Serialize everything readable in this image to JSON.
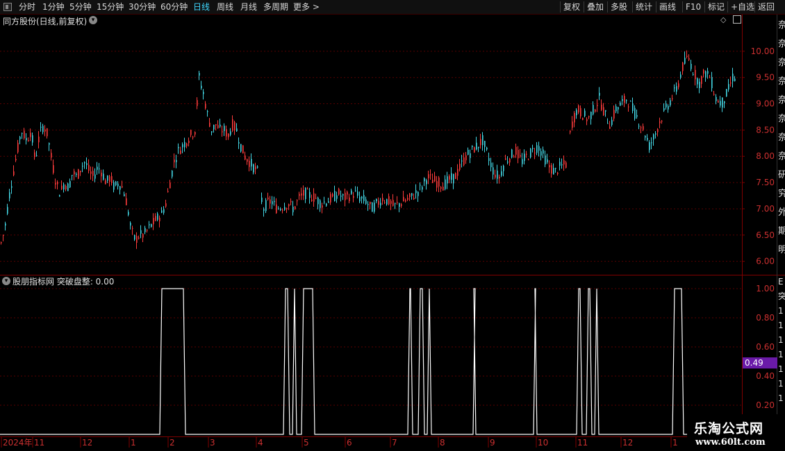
{
  "toolbar": {
    "left": [
      {
        "label": "分时",
        "x": 27
      },
      {
        "label": "1分钟",
        "x": 61
      },
      {
        "label": "5分钟",
        "x": 100
      },
      {
        "label": "15分钟",
        "x": 139
      },
      {
        "label": "30分钟",
        "x": 185
      },
      {
        "label": "60分钟",
        "x": 231
      },
      {
        "label": "日线",
        "x": 278,
        "active": true
      },
      {
        "label": "周线",
        "x": 312
      },
      {
        "label": "月线",
        "x": 346
      },
      {
        "label": "多周期",
        "x": 379
      },
      {
        "label": "更多 >",
        "x": 422
      }
    ],
    "right": [
      {
        "label": "复权",
        "x": 811
      },
      {
        "label": "叠加",
        "x": 845
      },
      {
        "label": "多股",
        "x": 879
      },
      {
        "label": "统计",
        "x": 915
      },
      {
        "label": "画线",
        "x": 949
      },
      {
        "label": "F10",
        "x": 987
      },
      {
        "label": "标记",
        "x": 1019
      },
      {
        "label": "+自选",
        "x": 1052
      },
      {
        "label": "返回",
        "x": 1091
      }
    ]
  },
  "main": {
    "title": "同方股份(日线,前复权)",
    "y_ticks": [
      "10.00",
      "9.50",
      "9.00",
      "8.50",
      "8.00",
      "7.50",
      "7.00",
      "6.50",
      "6.00"
    ],
    "right_edge_text": "奈奈奈奈奈奈奈奈研究外期明",
    "colors": {
      "up": "#ff3c3c",
      "down": "#44d8e6",
      "grid": "#5a0000",
      "border": "#800000"
    }
  },
  "indicator": {
    "title": "股朋指标网 突破盘整: 0.00",
    "y_ticks": [
      "1.00",
      "0.80",
      "0.60",
      "0.40",
      "0.20"
    ],
    "cursor_value": "0.49",
    "cursor_color": "#6a1aa8",
    "right_edge_text": "E突1111111",
    "line_color": "#ffffff"
  },
  "x_axis": {
    "labels": [
      {
        "t": "2024年",
        "x": 2
      },
      {
        "t": "11",
        "x": 47
      },
      {
        "t": "12",
        "x": 116
      },
      {
        "t": "1",
        "x": 186
      },
      {
        "t": "2",
        "x": 242
      },
      {
        "t": "3",
        "x": 300
      },
      {
        "t": "4",
        "x": 369
      },
      {
        "t": "5",
        "x": 435
      },
      {
        "t": "6",
        "x": 497
      },
      {
        "t": "7",
        "x": 562
      },
      {
        "t": "8",
        "x": 631
      },
      {
        "t": "9",
        "x": 703
      },
      {
        "t": "10",
        "x": 772
      },
      {
        "t": "11",
        "x": 829
      },
      {
        "t": "12",
        "x": 894
      },
      {
        "t": "1",
        "x": 966
      }
    ]
  },
  "watermark": {
    "line1": "乐淘公式网",
    "line2": "www.60lt.com"
  },
  "chart_data": [
    {
      "type": "candlestick",
      "title": "同方股份(日线,前复权)",
      "ylim": [
        5.85,
        10.5
      ],
      "anchors": [
        [
          0,
          6.3
        ],
        [
          6,
          6.6
        ],
        [
          12,
          7.2
        ],
        [
          20,
          7.8
        ],
        [
          30,
          8.5
        ],
        [
          38,
          8.3
        ],
        [
          44,
          8.5
        ],
        [
          50,
          7.9
        ],
        [
          56,
          8.4
        ],
        [
          62,
          8.6
        ],
        [
          68,
          8.4
        ],
        [
          74,
          7.9
        ],
        [
          80,
          7.5
        ],
        [
          86,
          7.3
        ],
        [
          92,
          7.5
        ],
        [
          98,
          7.4
        ],
        [
          104,
          7.7
        ],
        [
          110,
          7.6
        ],
        [
          116,
          7.8
        ],
        [
          122,
          7.9
        ],
        [
          128,
          7.7
        ],
        [
          134,
          7.6
        ],
        [
          140,
          7.8
        ],
        [
          146,
          7.7
        ],
        [
          152,
          7.5
        ],
        [
          158,
          7.6
        ],
        [
          164,
          7.4
        ],
        [
          170,
          7.5
        ],
        [
          176,
          7.4
        ],
        [
          182,
          7.1
        ],
        [
          188,
          6.6
        ],
        [
          194,
          6.4
        ],
        [
          200,
          6.5
        ],
        [
          206,
          6.5
        ],
        [
          212,
          6.6
        ],
        [
          218,
          6.7
        ],
        [
          224,
          6.8
        ],
        [
          232,
          6.9
        ],
        [
          238,
          7.1
        ],
        [
          244,
          7.5
        ],
        [
          250,
          7.9
        ],
        [
          256,
          8.1
        ],
        [
          262,
          8.2
        ],
        [
          268,
          8.3
        ],
        [
          274,
          8.4
        ],
        [
          280,
          8.5
        ],
        [
          286,
          9.5
        ],
        [
          292,
          9.2
        ],
        [
          298,
          8.8
        ],
        [
          304,
          8.5
        ],
        [
          310,
          8.6
        ],
        [
          316,
          8.5
        ],
        [
          322,
          8.5
        ],
        [
          328,
          8.4
        ],
        [
          334,
          8.6
        ],
        [
          340,
          8.5
        ],
        [
          346,
          8.2
        ],
        [
          352,
          8.0
        ],
        [
          358,
          7.9
        ],
        [
          364,
          7.8
        ],
        [
          370,
          7.7
        ],
        [
          378,
          7.0
        ],
        [
          384,
          7.1
        ],
        [
          390,
          7.15
        ],
        [
          398,
          7.0
        ],
        [
          406,
          7.05
        ],
        [
          414,
          7.1
        ],
        [
          422,
          7.0
        ],
        [
          430,
          7.2
        ],
        [
          438,
          7.3
        ],
        [
          446,
          7.25
        ],
        [
          454,
          7.2
        ],
        [
          462,
          7.1
        ],
        [
          470,
          7.15
        ],
        [
          478,
          7.2
        ],
        [
          486,
          7.3
        ],
        [
          494,
          7.2
        ],
        [
          502,
          7.25
        ],
        [
          510,
          7.3
        ],
        [
          518,
          7.2
        ],
        [
          526,
          7.15
        ],
        [
          534,
          7.0
        ],
        [
          542,
          7.1
        ],
        [
          550,
          7.2
        ],
        [
          558,
          7.15
        ],
        [
          566,
          7.05
        ],
        [
          574,
          7.1
        ],
        [
          582,
          7.15
        ],
        [
          590,
          7.2
        ],
        [
          598,
          7.3
        ],
        [
          606,
          7.4
        ],
        [
          614,
          7.6
        ],
        [
          622,
          7.55
        ],
        [
          630,
          7.5
        ],
        [
          638,
          7.45
        ],
        [
          646,
          7.55
        ],
        [
          654,
          7.6
        ],
        [
          662,
          7.8
        ],
        [
          670,
          8.0
        ],
        [
          678,
          8.1
        ],
        [
          686,
          8.2
        ],
        [
          694,
          8.3
        ],
        [
          702,
          8.0
        ],
        [
          710,
          7.7
        ],
        [
          718,
          7.6
        ],
        [
          726,
          7.9
        ],
        [
          734,
          8.0
        ],
        [
          742,
          8.1
        ],
        [
          750,
          7.9
        ],
        [
          758,
          8.0
        ],
        [
          766,
          8.1
        ],
        [
          774,
          8.2
        ],
        [
          782,
          8.0
        ],
        [
          790,
          7.8
        ],
        [
          798,
          7.7
        ],
        [
          806,
          7.8
        ],
        [
          814,
          7.85
        ],
        [
          822,
          8.6
        ],
        [
          830,
          8.9
        ],
        [
          838,
          8.8
        ],
        [
          846,
          8.7
        ],
        [
          854,
          8.9
        ],
        [
          862,
          9.1
        ],
        [
          870,
          8.8
        ],
        [
          878,
          8.6
        ],
        [
          886,
          8.9
        ],
        [
          894,
          9.0
        ],
        [
          902,
          9.1
        ],
        [
          910,
          8.9
        ],
        [
          918,
          8.7
        ],
        [
          926,
          8.5
        ],
        [
          934,
          8.2
        ],
        [
          942,
          8.4
        ],
        [
          950,
          8.7
        ],
        [
          958,
          8.9
        ],
        [
          966,
          9.1
        ],
        [
          974,
          9.3
        ],
        [
          982,
          9.7
        ],
        [
          990,
          9.9
        ],
        [
          998,
          9.6
        ],
        [
          1006,
          9.4
        ],
        [
          1014,
          9.6
        ],
        [
          1022,
          9.5
        ],
        [
          1030,
          9.1
        ],
        [
          1038,
          9.0
        ],
        [
          1046,
          9.2
        ],
        [
          1054,
          9.5
        ],
        [
          1060,
          9.5
        ]
      ],
      "gaps": [
        [
          372,
          376
        ],
        [
          816,
          820
        ]
      ]
    },
    {
      "type": "line",
      "title": "突破盘整",
      "ylim": [
        0,
        1
      ],
      "pulses": [
        [
          230,
          267
        ],
        [
          408,
          417
        ],
        [
          421,
          427
        ],
        [
          434,
          453
        ],
        [
          587,
          594
        ],
        [
          602,
          611
        ],
        [
          615,
          621
        ],
        [
          681,
          685
        ],
        [
          768,
          773
        ],
        [
          830,
          838
        ],
        [
          844,
          852
        ],
        [
          856,
          862
        ],
        [
          968,
          984
        ]
      ]
    }
  ]
}
